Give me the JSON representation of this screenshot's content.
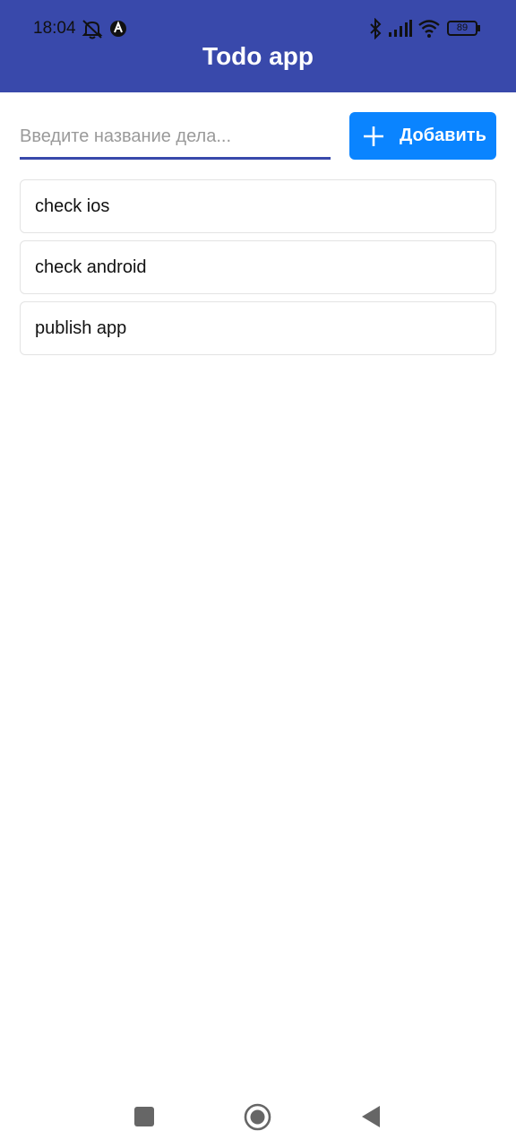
{
  "status_bar": {
    "time": "18:04",
    "battery": "89",
    "icons": [
      "alarm-off-icon",
      "app-notification-icon",
      "bluetooth-icon",
      "signal-icon",
      "wifi-icon",
      "battery-icon"
    ]
  },
  "app_bar": {
    "title": "Todo app",
    "color": "#3949ab"
  },
  "form": {
    "input_value": "",
    "placeholder": "Введите название дела...",
    "add_label": "Добавить",
    "add_icon": "plus-icon",
    "button_color": "#0a84ff"
  },
  "todos": [
    {
      "title": "check ios"
    },
    {
      "title": "check android"
    },
    {
      "title": "publish app"
    }
  ],
  "nav_bar": {
    "buttons": [
      "recents-square-icon",
      "home-circle-icon",
      "back-triangle-icon"
    ]
  }
}
